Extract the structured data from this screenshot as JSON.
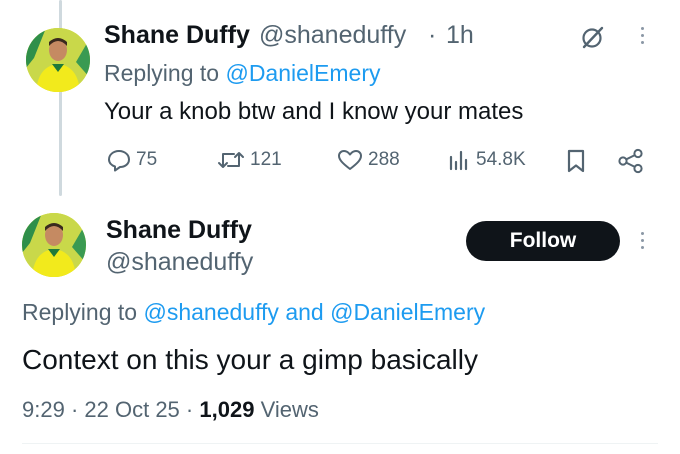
{
  "tweet1": {
    "name": "Shane Duffy",
    "handle": "@shaneduffy",
    "separator": "·",
    "time": "1h",
    "replying_prefix": "Replying to ",
    "replying_to": "@DanielEmery",
    "text": "Your a knob btw and I know your mates",
    "actions": {
      "replies": "75",
      "retweets": "121",
      "likes": "288",
      "views": "54.8K"
    },
    "icons": [
      "grok-icon",
      "more-icon",
      "reply-icon",
      "retweet-icon",
      "like-icon",
      "views-icon",
      "bookmark-icon",
      "share-icon"
    ]
  },
  "tweet2": {
    "name": "Shane Duffy",
    "handle": "@shaneduffy",
    "follow_label": "Follow",
    "replying_prefix": "Replying to ",
    "replying_to_1": "@shaneduffy",
    "replying_and": " and ",
    "replying_to_2": "@DanielEmery",
    "text": "Context on this your a gimp basically",
    "time": "9:29",
    "separator": "·",
    "date": "22 Oct 25",
    "views_count": "1,029",
    "views_label": "Views"
  },
  "colors": {
    "accent": "#1d9bf0",
    "text": "#0f1419",
    "muted": "#536471",
    "thread_line": "#cfd9de",
    "avatar_kit": "#e8e620"
  }
}
